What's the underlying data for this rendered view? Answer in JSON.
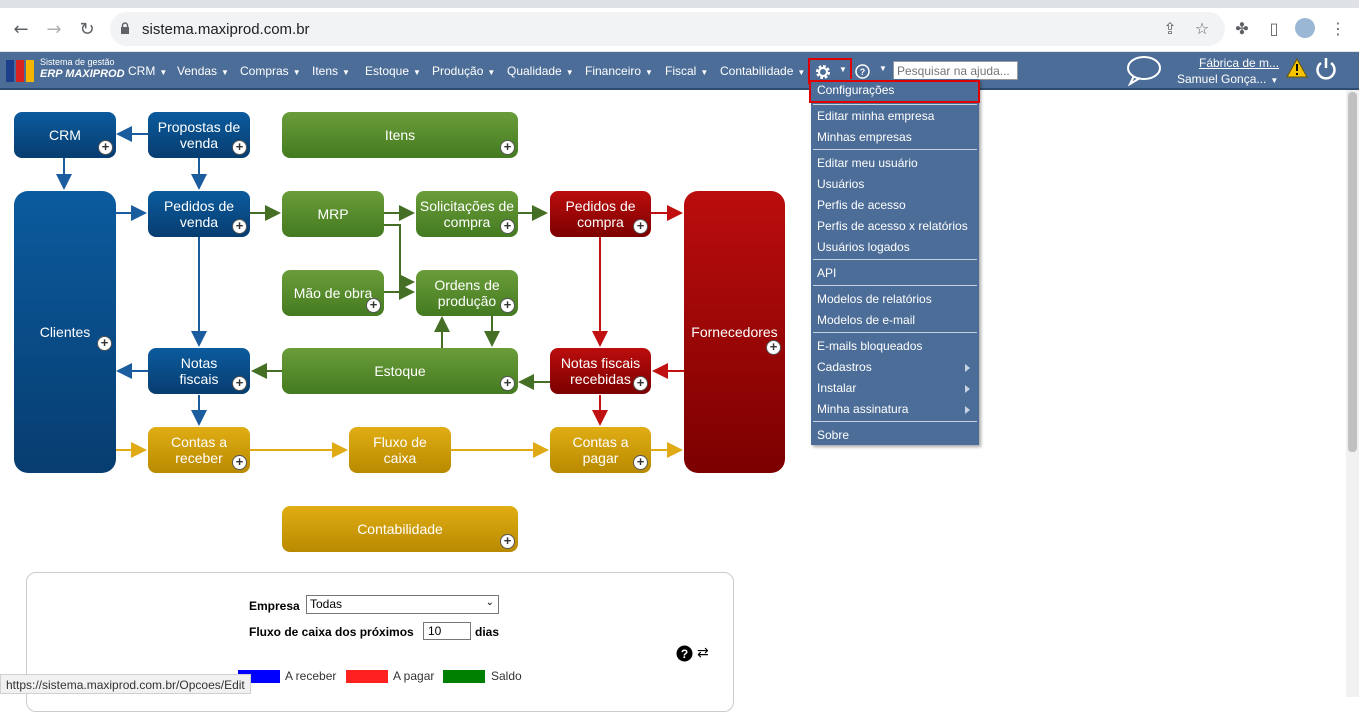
{
  "browser": {
    "url": "sistema.maxiprod.com.br",
    "status_url": "https://sistema.maxiprod.com.br/Opcoes/Edit"
  },
  "app": {
    "logo_line1": "Sistema de gestão",
    "logo_line2": "ERP MAXIPROD",
    "menus": [
      "CRM",
      "Vendas",
      "Compras",
      "Itens",
      "Estoque",
      "Produção",
      "Qualidade",
      "Financeiro",
      "Fiscal",
      "Contabilidade"
    ],
    "help_placeholder": "Pesquisar na ajuda...",
    "company": "Fábrica de m...",
    "user": "Samuel Gonça..."
  },
  "dropdown": {
    "items": [
      {
        "label": "Configurações"
      },
      {
        "label": "Editar minha empresa"
      },
      {
        "label": "Minhas empresas"
      },
      {
        "label": "Editar meu usuário"
      },
      {
        "label": "Usuários"
      },
      {
        "label": "Perfis de acesso"
      },
      {
        "label": "Perfis de acesso x relatórios"
      },
      {
        "label": "Usuários logados"
      },
      {
        "label": "API"
      },
      {
        "label": "Modelos de relatórios"
      },
      {
        "label": "Modelos de e-mail"
      },
      {
        "label": "E-mails bloqueados"
      },
      {
        "label": "Cadastros"
      },
      {
        "label": "Instalar"
      },
      {
        "label": "Minha assinatura"
      },
      {
        "label": "Sobre"
      }
    ]
  },
  "flow": {
    "crm": "CRM",
    "propostas_1": "Propostas de",
    "propostas_2": "venda",
    "itens": "Itens",
    "clientes": "Clientes",
    "pedidos_venda_1": "Pedidos de",
    "pedidos_venda_2": "venda",
    "mrp": "MRP",
    "solicitacoes_1": "Solicitações de",
    "solicitacoes_2": "compra",
    "pedidos_compra_1": "Pedidos de",
    "pedidos_compra_2": "compra",
    "fornecedores": "Fornecedores",
    "mao_obra": "Mão de obra",
    "ordens_1": "Ordens de",
    "ordens_2": "produção",
    "notas_fiscais_1": "Notas",
    "notas_fiscais_2": "fiscais",
    "estoque": "Estoque",
    "notas_recebidas_1": "Notas fiscais",
    "notas_recebidas_2": "recebidas",
    "contas_receber_1": "Contas a",
    "contas_receber_2": "receber",
    "fluxo_caixa_1": "Fluxo de",
    "fluxo_caixa_2": "caixa",
    "contas_pagar_1": "Contas a",
    "contas_pagar_2": "pagar",
    "contabilidade": "Contabilidade"
  },
  "panel": {
    "empresa_label": "Empresa",
    "empresa_value": "Todas",
    "fluxo_label": "Fluxo de caixa dos próximos",
    "fluxo_value": "10",
    "dias_label": "dias",
    "legend": [
      {
        "label": "A receber",
        "color": "#0000ff"
      },
      {
        "label": "A pagar",
        "color": "#ff2020"
      },
      {
        "label": "Saldo",
        "color": "#008000"
      }
    ]
  }
}
